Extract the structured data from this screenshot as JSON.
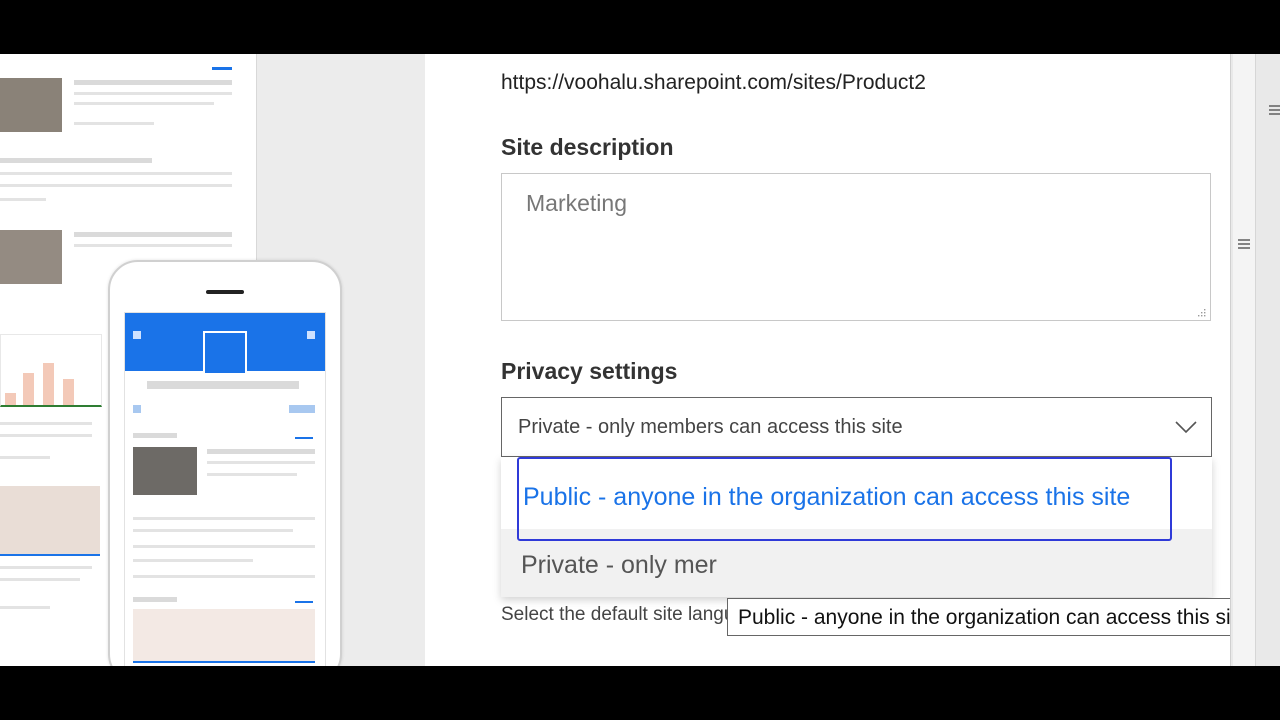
{
  "site": {
    "url": "https://voohalu.sharepoint.com/sites/Product2"
  },
  "description": {
    "label": "Site description",
    "value": "Marketing"
  },
  "privacy": {
    "label": "Privacy settings",
    "selected": "Private - only members can access this site",
    "options": [
      "Public - anyone in the organization can access this site",
      "Private - only mer"
    ],
    "tooltip": "Public - anyone in the organization can access this site"
  },
  "language": {
    "help_text": "Select the default site language for your site. You can't change this later."
  },
  "icons": {
    "dropdown": "chevron-down-icon",
    "resize": "resize-grip-icon",
    "scroll": "grip-lines-icon"
  },
  "colors": {
    "accent": "#1a73e8",
    "focus_border": "#2f3ad8"
  }
}
